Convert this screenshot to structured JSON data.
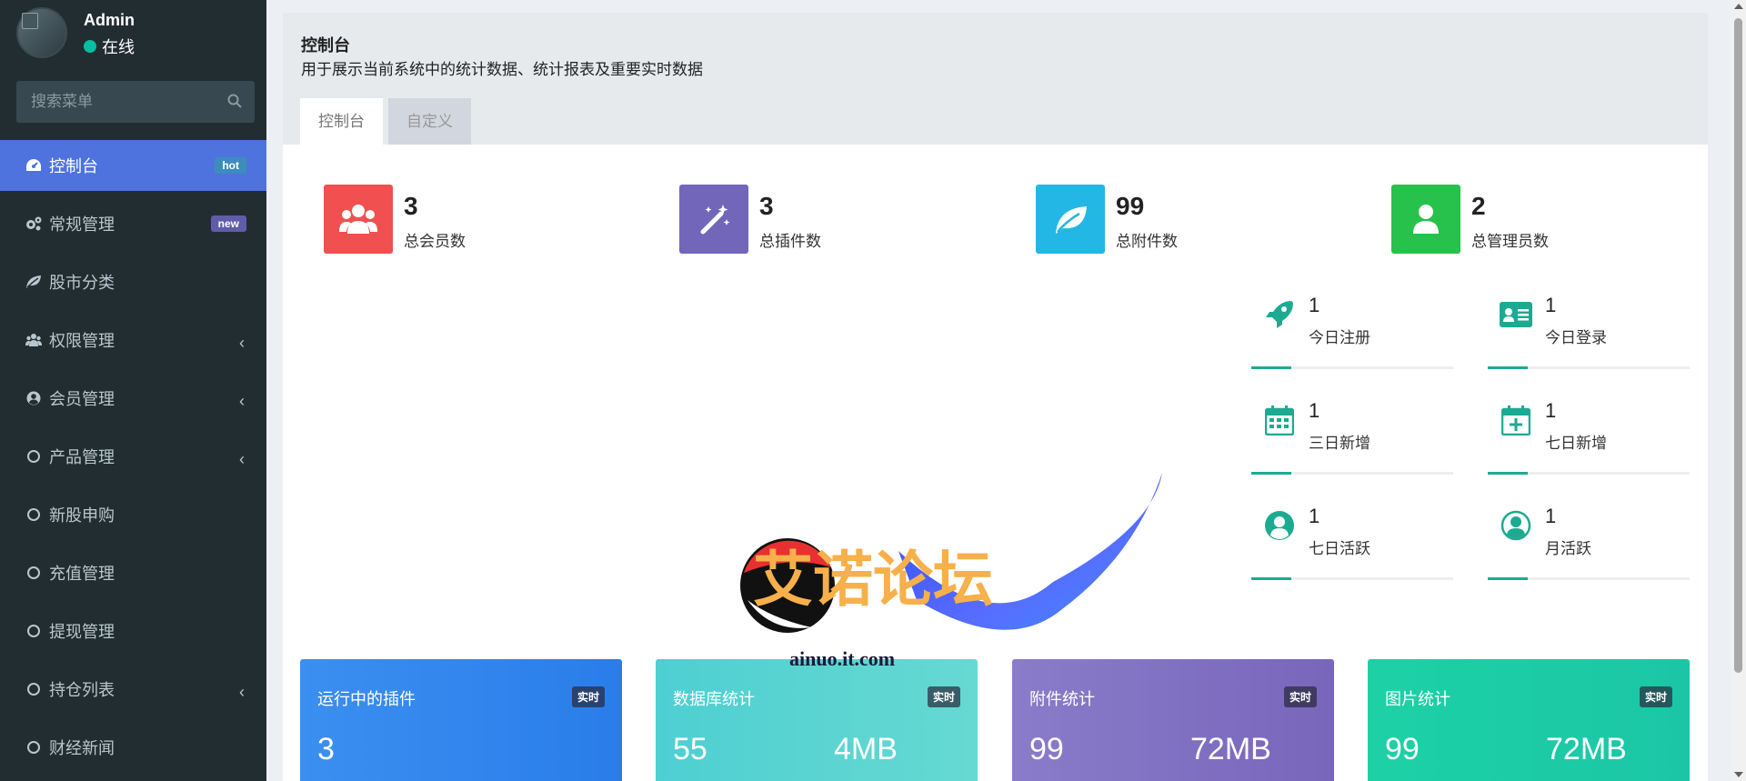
{
  "user": {
    "name": "Admin",
    "status": "在线"
  },
  "search": {
    "placeholder": "搜索菜单"
  },
  "menu": [
    {
      "label": "控制台",
      "badge": "hot",
      "icon": "dashboard-icon",
      "active": true
    },
    {
      "label": "常规管理",
      "badge": "new",
      "icon": "cogs-icon"
    },
    {
      "label": "股市分类",
      "icon": "leaf-icon"
    },
    {
      "label": "权限管理",
      "icon": "users-icon",
      "chevron": "‹"
    },
    {
      "label": "会员管理",
      "icon": "user-circle-icon",
      "chevron": "‹"
    },
    {
      "label": "产品管理",
      "icon": "circle-o-icon",
      "chevron": "‹"
    },
    {
      "label": "新股申购",
      "icon": "circle-o-icon"
    },
    {
      "label": "充值管理",
      "icon": "circle-o-icon"
    },
    {
      "label": "提现管理",
      "icon": "circle-o-icon"
    },
    {
      "label": "持仓列表",
      "icon": "circle-o-icon",
      "chevron": "‹"
    },
    {
      "label": "财经新闻",
      "icon": "circle-o-icon"
    }
  ],
  "header": {
    "title": "控制台",
    "description": "用于展示当前系统中的统计数据、统计报表及重要实时数据",
    "tabs": [
      "控制台",
      "自定义"
    ]
  },
  "stats": [
    {
      "value": "3",
      "label": "总会员数",
      "color": "#f05050",
      "icon": "users-icon"
    },
    {
      "value": "3",
      "label": "总插件数",
      "color": "#7266ba",
      "icon": "magic-wand-icon"
    },
    {
      "value": "99",
      "label": "总附件数",
      "color": "#23b7e5",
      "icon": "leaf-icon"
    },
    {
      "value": "2",
      "label": "总管理员数",
      "color": "#27c24c",
      "icon": "user-icon"
    }
  ],
  "mini_stats": [
    {
      "value": "1",
      "label": "今日注册",
      "icon": "rocket-icon"
    },
    {
      "value": "1",
      "label": "今日登录",
      "icon": "id-card-icon"
    },
    {
      "value": "1",
      "label": "三日新增",
      "icon": "calendar-icon"
    },
    {
      "value": "1",
      "label": "七日新增",
      "icon": "calendar-plus-icon"
    },
    {
      "value": "1",
      "label": "七日活跃",
      "icon": "user-circle-icon"
    },
    {
      "value": "1",
      "label": "月活跃",
      "icon": "user-circle-o-icon"
    }
  ],
  "cards": [
    {
      "title": "运行中的插件",
      "badge": "实时",
      "value1": "3",
      "value2": "",
      "gradient": [
        "#3b8ff0",
        "#2a7de9"
      ]
    },
    {
      "title": "数据库统计",
      "badge": "实时",
      "value1": "55",
      "value2": "4MB",
      "gradient": [
        "#4ecfd2",
        "#62d8d3"
      ]
    },
    {
      "title": "附件统计",
      "badge": "实时",
      "value1": "99",
      "value2": "72MB",
      "gradient": [
        "#8878c7",
        "#7866bb"
      ]
    },
    {
      "title": "图片统计",
      "badge": "实时",
      "value1": "99",
      "value2": "72MB",
      "gradient": [
        "#1dcfa4",
        "#1bc7a6"
      ]
    }
  ],
  "watermark": {
    "text": "艾诺论坛",
    "url": "ainuo.it.com"
  },
  "accent": "#1cab92"
}
